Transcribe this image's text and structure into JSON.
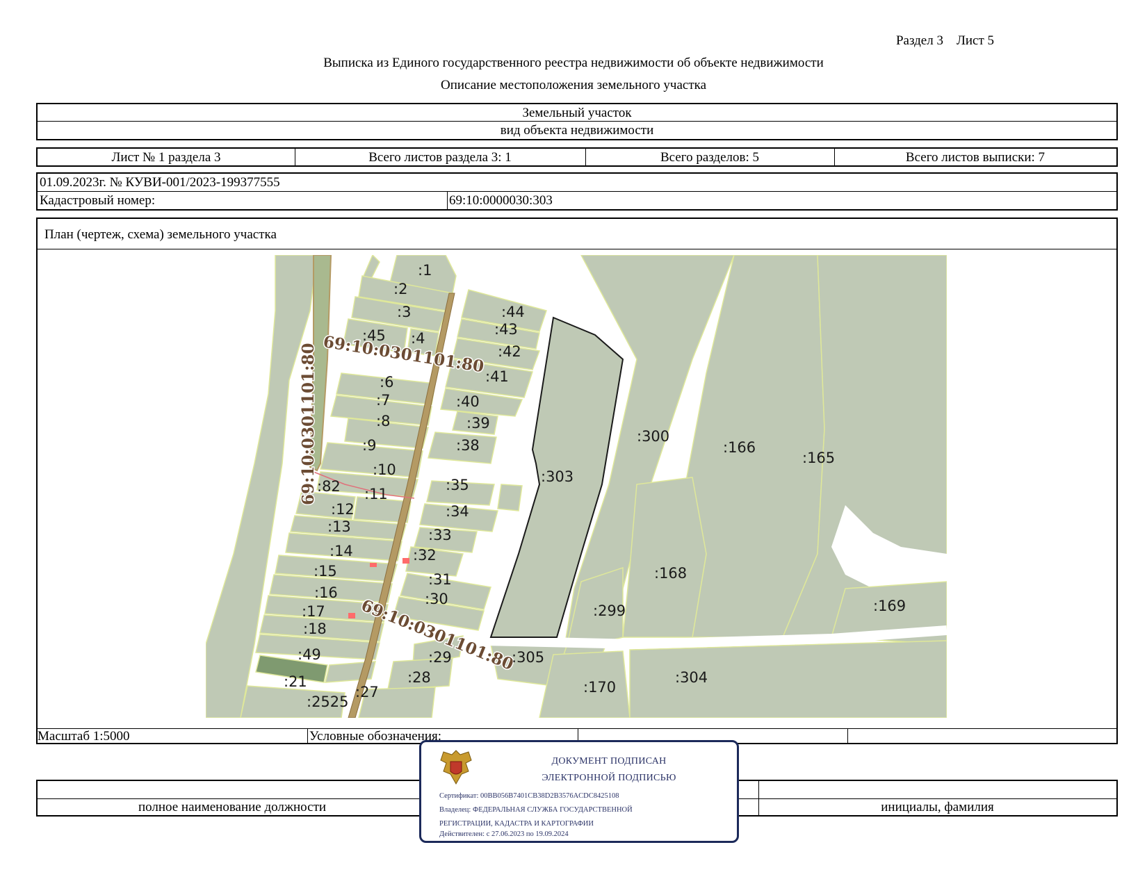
{
  "header": {
    "section": "Раздел 3",
    "sheet": "Лист 5",
    "title": "Выписка из Единого государственного реестра недвижимости об объекте недвижимости",
    "subtitle": "Описание местоположения земельного участка"
  },
  "object": {
    "type_value": "Земельный участок",
    "type_caption": "вид объекта недвижимости"
  },
  "sheets_row": {
    "sheet_no": "Лист № 1 раздела 3",
    "total_sheets_section": "Всего листов раздела 3: 1",
    "total_sections": "Всего разделов: 5",
    "total_sheets_extract": "Всего листов выписки: 7"
  },
  "record": {
    "date_number": "01.09.2023г. № КУВИ-001/2023-199377555",
    "cadastral_label": "Кадастровый номер:",
    "cadastral_value": "69:10:0000030:303"
  },
  "plan": {
    "title": "План (чертеж, схема) земельного участка",
    "road_label_1": "69:10:0301101:80",
    "road_label_2": "69:10:0301101:80",
    "road_label_3": "69:10:0301101:80",
    "parcel_labels": [
      ":1",
      ":2",
      ":3",
      ":45",
      ":4",
      ":44",
      ":43",
      ":42",
      ":41",
      ":6",
      ":40",
      ":7",
      ":39",
      ":8",
      ":38",
      ":9",
      ":10",
      ":35",
      ":82",
      ":11",
      ":34",
      ":12",
      ":13",
      ":33",
      ":14",
      ":32",
      ":15",
      ":31",
      ":16",
      ":30",
      ":17",
      ":18",
      ":49",
      ":29",
      ":21",
      ":28",
      ":2525",
      ":27",
      ":303",
      ":300",
      ":166",
      ":165",
      ":168",
      ":299",
      ":169",
      ":305",
      ":304",
      ":170"
    ],
    "colors": {
      "parcel_fill": "#bfc9b5",
      "parcel_border": "#dfe89a",
      "target_border": "#1a1a1a",
      "road_fill": "#b49a64",
      "dark_parcel": "#7f9a70",
      "marker_red": "#ff6b6b"
    }
  },
  "footer_row": {
    "scale": "Масштаб 1:5000",
    "legend": "Условные обозначения:"
  },
  "signature": {
    "position_caption": "полное наименование должности",
    "name_caption": "инициалы, фамилия"
  },
  "stamp": {
    "line1": "ДОКУМЕНТ ПОДПИСАН",
    "line2": "ЭЛЕКТРОННОЙ ПОДПИСЬЮ",
    "certificate": "Сертификат: 00BB056B7401CB38D2B3576ACDC8425108",
    "owner1": "Владелец: ФЕДЕРАЛЬНАЯ СЛУЖБА ГОСУДАРСТВЕННОЙ",
    "owner2": "РЕГИСТРАЦИИ, КАДАСТРА И КАРТОГРАФИИ",
    "valid": "Действителен: с 27.06.2023 по 19.09.2024",
    "emblem": "coat-of-arms-emblem"
  }
}
